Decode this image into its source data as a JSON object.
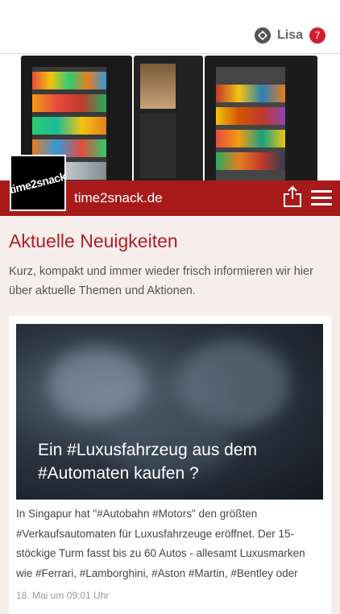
{
  "header": {
    "user_name": "Lisa",
    "notification_count": "7",
    "user_icon": "app-logo-icon"
  },
  "brand": {
    "logo_text": "time2snack",
    "site_name": "time2snack.de",
    "accent_color": "#a81a1a"
  },
  "news": {
    "title": "Aktuelle Neuigkeiten",
    "intro": "Kurz, kompakt und immer wieder frisch informieren wir hier über aktuelle Themen und Aktionen.",
    "articles": [
      {
        "title": "Ein #Luxusfahrzeug aus dem #Automaten kaufen ?",
        "text": "In Singapur hat \"#Autobahn #Motors\" den größten #Verkaufsautomaten für Luxusfahrzeuge eröffnet. Der 15-stöckige Turm fasst bis zu 60 Autos - allesamt Luxusmarken wie #Ferrari, #Lamborghini, #Aston #Martin, #Bentley oder",
        "date": "18. Mai um 09:01 Uhr"
      }
    ]
  },
  "icons": {
    "share": "share-icon",
    "menu": "hamburger-menu-icon"
  }
}
